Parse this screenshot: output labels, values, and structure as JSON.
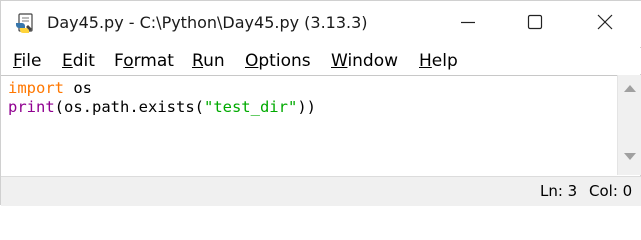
{
  "window": {
    "title": "Day45.py - C:\\Python\\Day45.py (3.13.3)"
  },
  "menu": [
    {
      "pre": "",
      "accel": "F",
      "post": "ile"
    },
    {
      "pre": "",
      "accel": "E",
      "post": "dit"
    },
    {
      "pre": "F",
      "accel": "o",
      "post": "rmat"
    },
    {
      "pre": "",
      "accel": "R",
      "post": "un"
    },
    {
      "pre": "",
      "accel": "O",
      "post": "ptions"
    },
    {
      "pre": "",
      "accel": "W",
      "post": "indow"
    },
    {
      "pre": "",
      "accel": "H",
      "post": "elp"
    }
  ],
  "code": {
    "line1": {
      "keyword": "import",
      "rest": " os"
    },
    "line2": {
      "builtin": "print",
      "before": "(os.path.exists(",
      "string": "\"test_dir\"",
      "after": "))"
    }
  },
  "status": {
    "ln": "Ln: 3",
    "col": "Col: 0"
  },
  "colors": {
    "keyword": "#ff7700",
    "builtin": "#900090",
    "string": "#00aa00"
  },
  "icons": {
    "app": "idle-python-icon",
    "minimize": "minimize-icon",
    "maximize": "maximize-icon",
    "close": "close-icon"
  }
}
